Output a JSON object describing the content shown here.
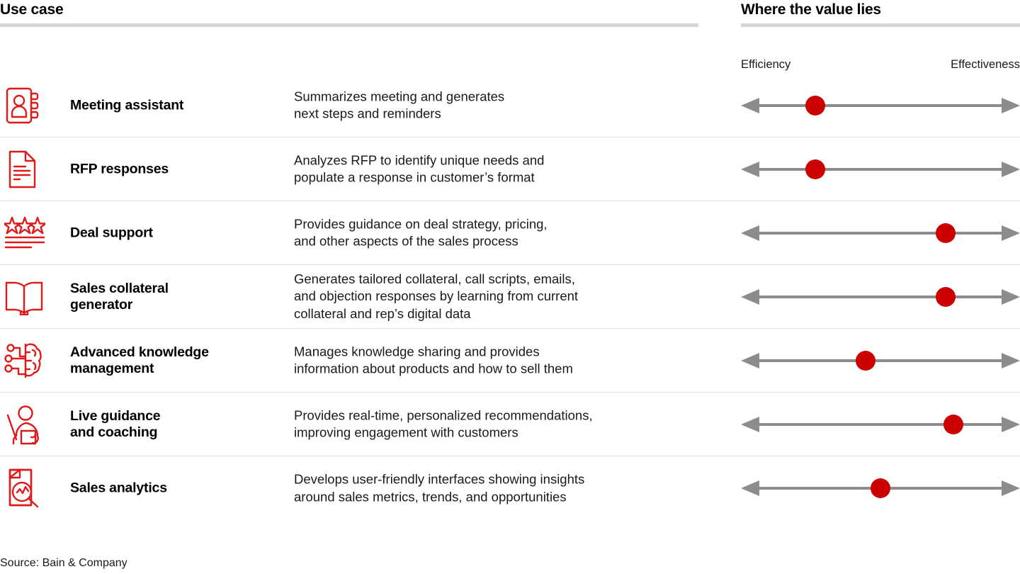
{
  "header": {
    "left_title": "Use case",
    "right_title": "Where the value lies",
    "rule_color": "#d6d6d6"
  },
  "axis": {
    "left_label": "Efficiency",
    "right_label": "Effectiveness",
    "line_color": "#8c8c8c",
    "dot_color": "#cc0000"
  },
  "rows": [
    {
      "icon": "address-book-icon",
      "title": "Meeting assistant",
      "description": "Summarizes meeting and generates next steps and reminders",
      "desc_line1": "Summarizes meeting and generates",
      "desc_line2": "next steps and reminders",
      "value_position_pct": 23
    },
    {
      "icon": "document-lines-icon",
      "title": "RFP responses",
      "description": "Analyzes RFP to identify unique needs and populate a response in customer’s format",
      "desc_line1": "Analyzes RFP to identify unique needs and",
      "desc_line2": "populate a response in customer’s format",
      "value_position_pct": 23
    },
    {
      "icon": "three-stars-icon",
      "title": "Deal support",
      "description": "Provides guidance on deal strategy, pricing, and other aspects of the sales process",
      "desc_line1": "Provides guidance on deal strategy, pricing,",
      "desc_line2": "and other aspects of the sales process",
      "value_position_pct": 77
    },
    {
      "icon": "open-book-icon",
      "title": "Sales collateral generator",
      "title_line1": "Sales collateral",
      "title_line2": "generator",
      "description": "Generates tailored collateral, call scripts, emails, and objection responses by learning from current collateral and rep’s digital data",
      "desc_line1": "Generates tailored collateral, call scripts, emails,",
      "desc_line2": "and objection responses by learning from current",
      "desc_line3": "collateral and rep’s digital data",
      "value_position_pct": 77
    },
    {
      "icon": "ai-brain-icon",
      "title": "Advanced knowledge management",
      "title_line1": "Advanced knowledge",
      "title_line2": "management",
      "description": "Manages knowledge sharing and provides information about products and how to sell them",
      "desc_line1": "Manages knowledge sharing and provides",
      "desc_line2": "information about products and how to sell them",
      "value_position_pct": 44
    },
    {
      "icon": "presenter-person-icon",
      "title": "Live guidance and coaching",
      "title_line1": "Live guidance",
      "title_line2": "and coaching",
      "description": "Provides real-time, personalized recommendations, improving engagement with customers",
      "desc_line1": "Provides real-time, personalized recommendations,",
      "desc_line2": "improving engagement with customers",
      "value_position_pct": 80
    },
    {
      "icon": "document-magnifier-chart-icon",
      "title": "Sales analytics",
      "description": "Develops user-friendly interfaces showing insights around sales metrics, trends, and opportunities",
      "desc_line1": "Develops user-friendly interfaces showing insights",
      "desc_line2": "around sales metrics, trends, and opportunities",
      "value_position_pct": 50
    }
  ],
  "source": "Source: Bain & Company"
}
